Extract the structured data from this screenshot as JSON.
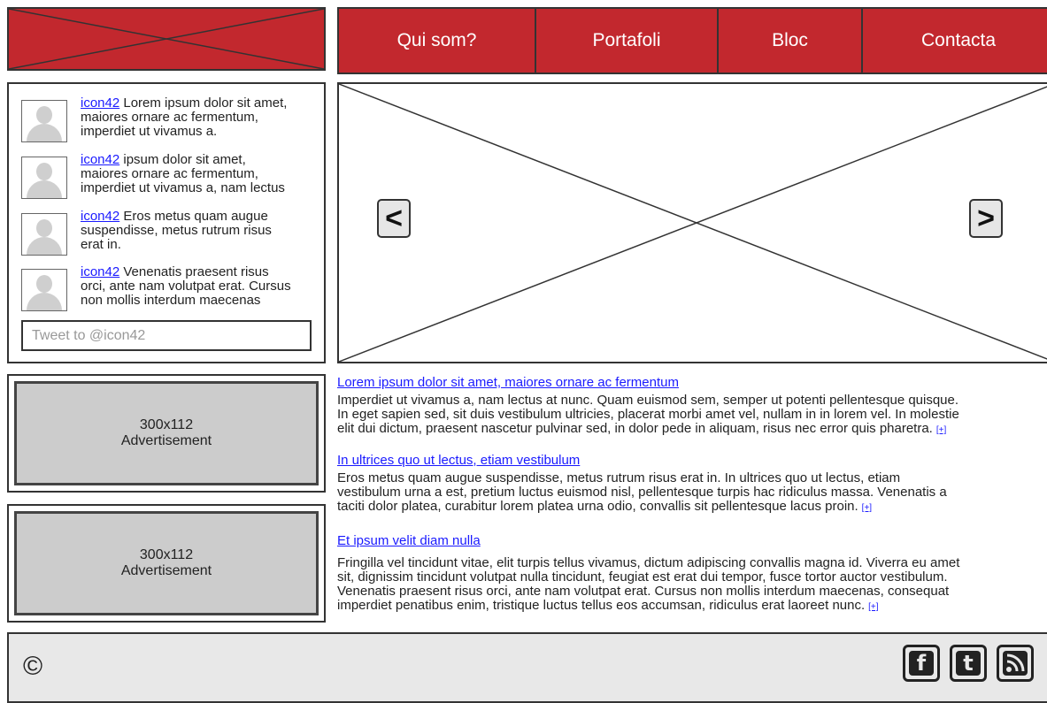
{
  "header": {
    "logo_icon": "image-placeholder-icon",
    "nav": [
      {
        "label": "Qui som?"
      },
      {
        "label": "Portafoli"
      },
      {
        "label": "Bloc"
      },
      {
        "label": "Contacta"
      }
    ]
  },
  "tweets": {
    "items": [
      {
        "user": "icon42",
        "lines": [
          "Lorem ipsum dolor sit amet,",
          "maiores ornare ac fermentum,",
          "imperdiet ut vivamus a."
        ]
      },
      {
        "user": "icon42",
        "lines": [
          "ipsum dolor sit amet,",
          "maiores ornare ac fermentum,",
          "imperdiet ut vivamus a, nam lectus"
        ]
      },
      {
        "user": "icon42",
        "lines": [
          "Eros metus quam augue",
          "suspendisse, metus rutrum risus",
          "erat in."
        ]
      },
      {
        "user": "icon42",
        "lines": [
          "Venenatis praesent risus",
          "orci, ante nam volutpat erat. Cursus",
          "non mollis interdum maecenas"
        ]
      }
    ],
    "input_placeholder": "Tweet to @icon42",
    "avatar_icon": "user-avatar-icon"
  },
  "ads": [
    {
      "size": "300x112",
      "label": "Advertisement"
    },
    {
      "size": "300x112",
      "label": "Advertisement"
    }
  ],
  "hero": {
    "prev_label": "<",
    "next_label": ">",
    "prev_icon": "chevron-left-icon",
    "next_icon": "chevron-right-icon"
  },
  "articles": [
    {
      "title": "Lorem ipsum dolor sit amet, maiores ornare ac fermentum",
      "lines": [
        "Imperdiet ut vivamus a, nam lectus at nunc. Quam euismod sem, semper ut potenti pellentesque quisque.",
        "In eget sapien sed, sit duis vestibulum ultricies, placerat morbi amet vel, nullam in in lorem vel. In molestie",
        "elit dui dictum, praesent nascetur pulvinar sed, in dolor pede in aliquam, risus nec error quis pharetra."
      ],
      "more": "[+]"
    },
    {
      "title": "In ultrices quo ut lectus, etiam vestibulum",
      "lines": [
        "Eros metus quam augue suspendisse, metus rutrum risus erat in.  In ultrices quo ut lectus, etiam",
        "vestibulum urna a est, pretium luctus euismod nisl, pellentesque turpis hac ridiculus massa. Venenatis a",
        "taciti dolor platea, curabitur lorem platea urna odio, convallis sit pellentesque lacus proin."
      ],
      "more": "[+]"
    },
    {
      "title": "Et ipsum velit diam nulla",
      "lines": [
        "Fringilla vel tincidunt vitae, elit turpis tellus vivamus, dictum adipiscing convallis magna id. Viverra eu amet",
        "sit, dignissim tincidunt volutpat nulla tincidunt, feugiat est erat dui tempor, fusce tortor auctor vestibulum.",
        "Venenatis praesent risus orci, ante nam volutpat erat. Cursus non mollis interdum maecenas, consequat",
        "imperdiet penatibus enim, tristique luctus tellus eos accumsan, ridiculus erat laoreet nunc."
      ],
      "more": "[+]"
    }
  ],
  "footer": {
    "copyright": "©",
    "social": [
      {
        "name": "facebook-icon",
        "glyph": "f"
      },
      {
        "name": "twitter-icon",
        "glyph": "t"
      },
      {
        "name": "rss-icon",
        "glyph": ""
      }
    ]
  },
  "colors": {
    "brand_red": "#c2282e",
    "link_blue": "#1a1aff",
    "ad_gray": "#cccccc",
    "footer_gray": "#e8e8e8"
  }
}
